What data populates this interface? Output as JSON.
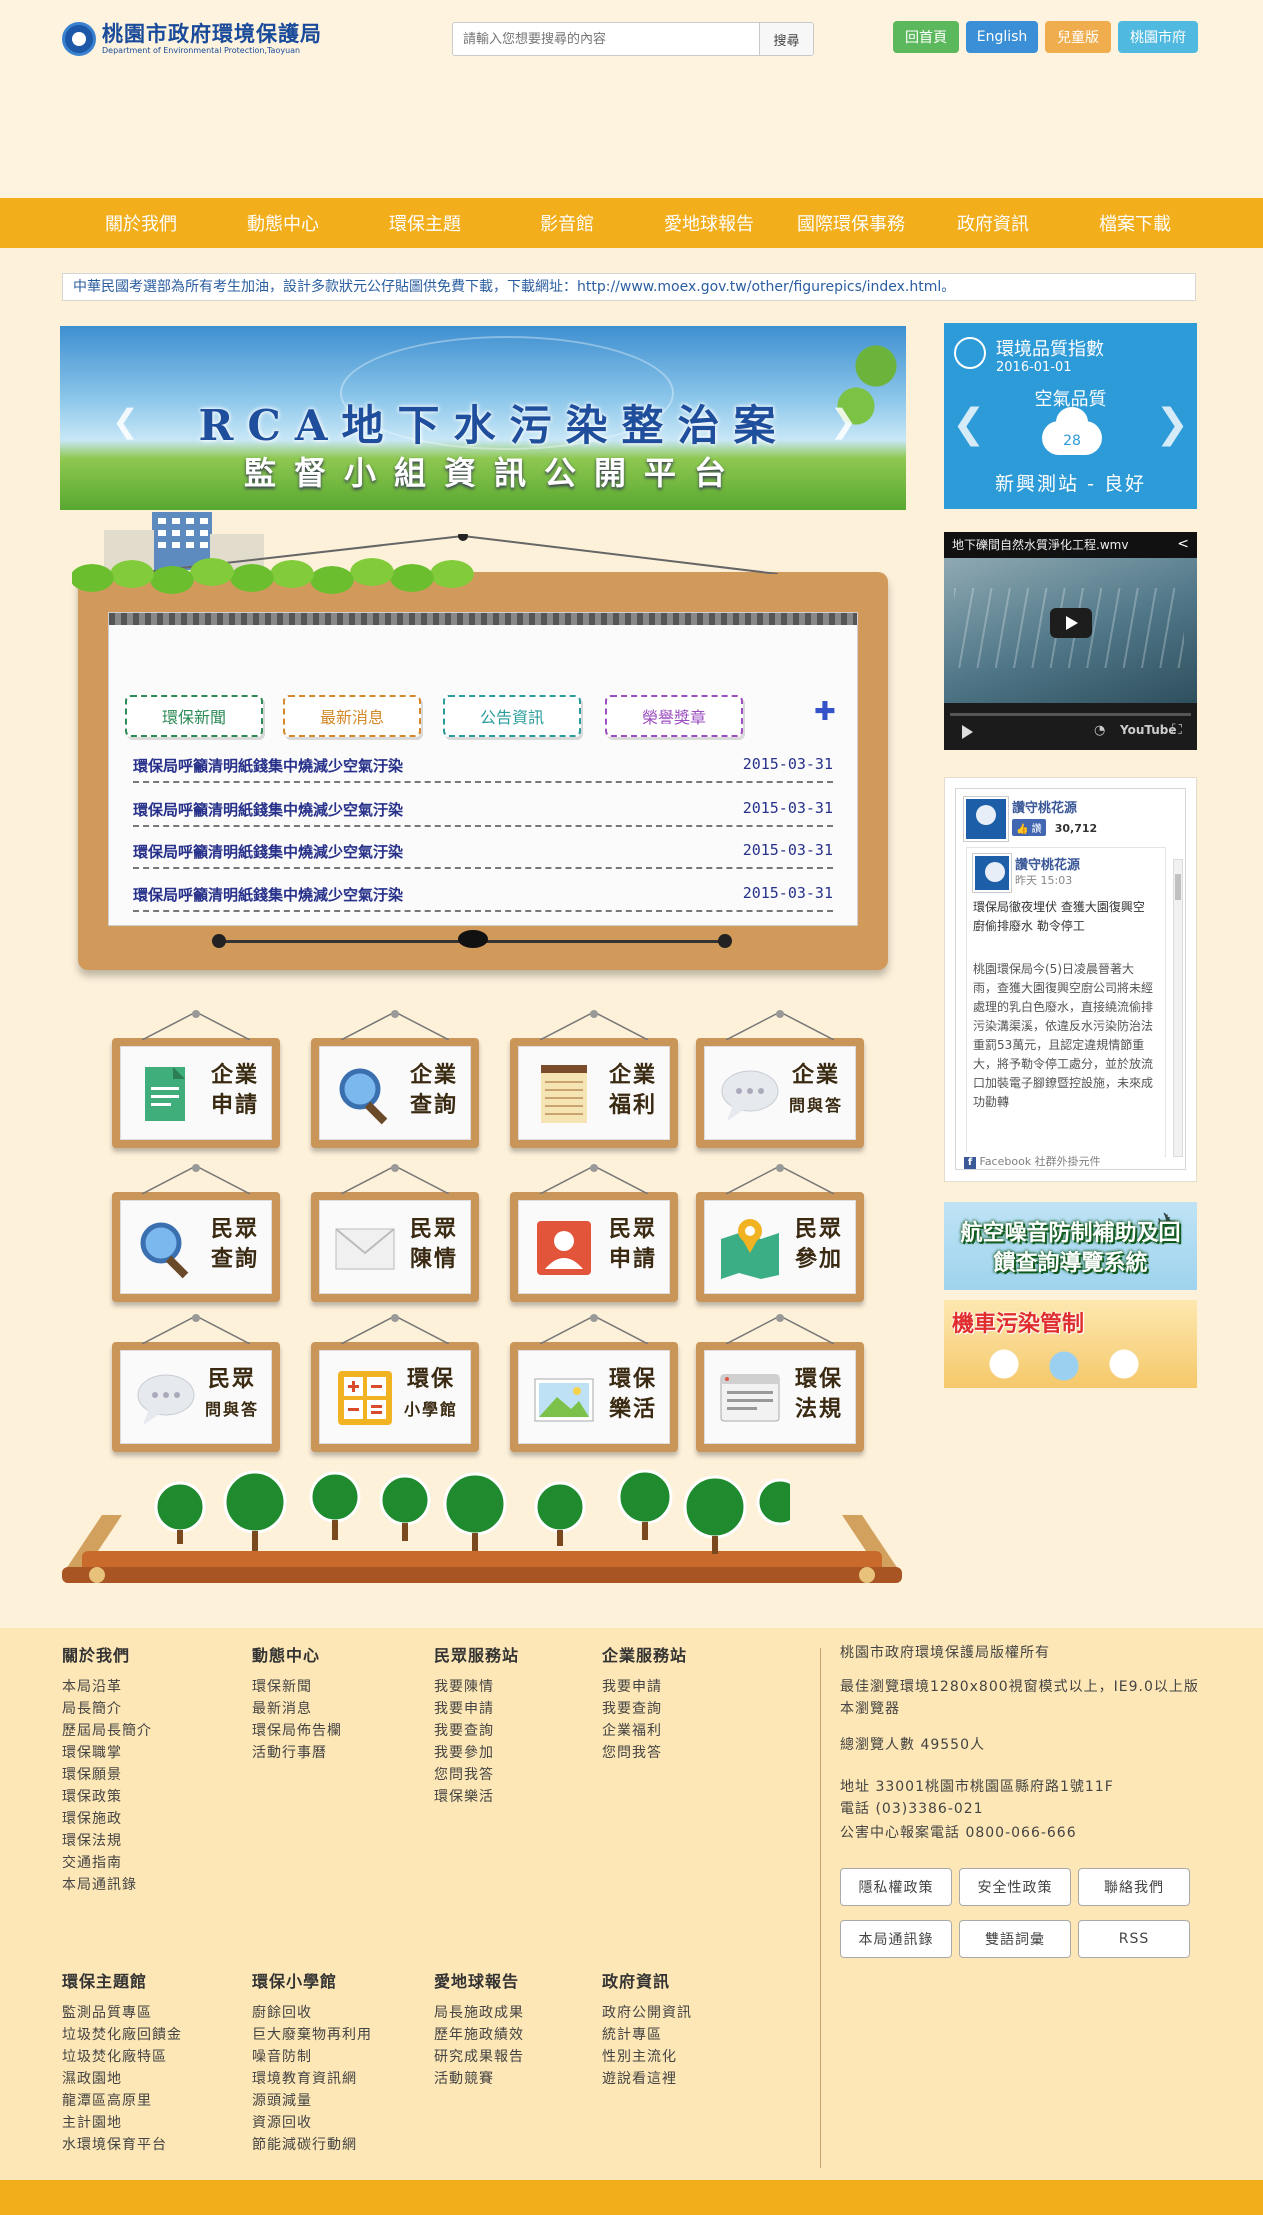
{
  "header": {
    "logo_title": "桃園市政府環境保護局",
    "logo_subtitle": "Department of Environmental Protection,Taoyuan",
    "search_placeholder": "請輸入您想要搜尋的內容",
    "search_button": "搜尋",
    "top_links": [
      {
        "label": "回首頁",
        "color": "#5cb85c"
      },
      {
        "label": "English",
        "color": "#3a8fd6"
      },
      {
        "label": "兒童版",
        "color": "#f0ad4e"
      },
      {
        "label": "桃園市府",
        "color": "#4fb9e0"
      }
    ]
  },
  "nav": [
    "關於我們",
    "動態中心",
    "環保主題",
    "影音館",
    "愛地球報告",
    "國際環保事務",
    "政府資訊",
    "檔案下載"
  ],
  "announcement": "中華民國考選部為所有考生加油，設計多款狀元公仔貼圖供免費下載，下載網址：http://www.moex.gov.tw/other/figurepics/index.html。",
  "banner": {
    "line1": "RCA地下水污染整治案",
    "line2": "監督小組資訊公開平台"
  },
  "aqi": {
    "title": "環境品質指數",
    "date": "2016-01-01",
    "subtitle": "空氣品質",
    "value": "28",
    "station": "新興測站 - 良好"
  },
  "video": {
    "title": "地下礫間自然水質淨化工程.wmv"
  },
  "facebook": {
    "page_name": "讚守桃花源",
    "like_label": "讚",
    "like_count": "30,712",
    "post_time": "昨天 15:03",
    "post_headline": "環保局徹夜埋伏 查獲大園復興空廚偷排廢水 勒令停工",
    "post_body": "桃園環保局今(5)日凌晨晉著大雨，查獲大園復興空廚公司將未經處理的乳白色廢水，直接繞流偷排污染溝渠溪，依違反水污染防治法重罰53萬元，且認定違規情節重大，將予勒令停工處分，並於放流口加裝電子腳鐐暨控設施，未來成功勸轉",
    "footer": "Facebook 社群外掛元件"
  },
  "ads": {
    "ad1": "航空噪音防制補助及回饋查詢導覽系統",
    "ad2": "機車污染管制"
  },
  "board": {
    "tabs": [
      {
        "label": "環保新聞",
        "color": "#2e8b57"
      },
      {
        "label": "最新消息",
        "color": "#d4892a"
      },
      {
        "label": "公告資訊",
        "color": "#2a9c9c"
      },
      {
        "label": "榮譽獎章",
        "color": "#9c4fc0"
      }
    ],
    "news": [
      {
        "title": "環保局呼籲清明紙錢集中燒減少空氣汙染",
        "date": "2015-03-31"
      },
      {
        "title": "環保局呼籲清明紙錢集中燒減少空氣汙染",
        "date": "2015-03-31"
      },
      {
        "title": "環保局呼籲清明紙錢集中燒減少空氣汙染",
        "date": "2015-03-31"
      },
      {
        "title": "環保局呼籲清明紙錢集中燒減少空氣汙染",
        "date": "2015-03-31"
      }
    ]
  },
  "tiles": [
    {
      "l1": "企業",
      "l2": "申請",
      "icon": "document-icon"
    },
    {
      "l1": "企業",
      "l2": "查詢",
      "icon": "magnifier-icon"
    },
    {
      "l1": "企業",
      "l2": "福利",
      "icon": "notepad-icon"
    },
    {
      "l1": "企業",
      "l2": "問與答",
      "icon": "chat-bubble-icon"
    },
    {
      "l1": "民眾",
      "l2": "查詢",
      "icon": "magnifier-icon"
    },
    {
      "l1": "民眾",
      "l2": "陳情",
      "icon": "envelope-icon"
    },
    {
      "l1": "民眾",
      "l2": "申請",
      "icon": "person-card-icon"
    },
    {
      "l1": "民眾",
      "l2": "參加",
      "icon": "map-pin-icon"
    },
    {
      "l1": "民眾",
      "l2": "問與答",
      "icon": "chat-bubble-icon"
    },
    {
      "l1": "環保",
      "l2": "小學館",
      "icon": "calculator-icon"
    },
    {
      "l1": "環保",
      "l2": "樂活",
      "icon": "picture-icon"
    },
    {
      "l1": "環保",
      "l2": "法規",
      "icon": "browser-window-icon"
    }
  ],
  "footer": {
    "columns_top": [
      {
        "title": "關於我們",
        "links": [
          "本局沿革",
          "局長簡介",
          "歷屆局長簡介",
          "環保職掌",
          "環保願景",
          "環保政策",
          "環保施政",
          "環保法規",
          "交通指南",
          "本局通訊錄"
        ]
      },
      {
        "title": "動態中心",
        "links": [
          "環保新聞",
          "最新消息",
          "環保局佈告欄",
          "活動行事曆"
        ]
      },
      {
        "title": "民眾服務站",
        "links": [
          "我要陳情",
          "我要申請",
          "我要查詢",
          "我要參加",
          "您問我答",
          "環保樂活"
        ]
      },
      {
        "title": "企業服務站",
        "links": [
          "我要申請",
          "我要查詢",
          "企業福利",
          "您問我答"
        ]
      }
    ],
    "columns_bottom": [
      {
        "title": "環保主題館",
        "links": [
          "監測品質專區",
          "垃圾焚化廠回饋金",
          "垃圾焚化廠特區",
          "濕政園地",
          "龍潭區高原里",
          "主計園地",
          "水環境保育平台"
        ]
      },
      {
        "title": "環保小學館",
        "links": [
          "廚餘回收",
          "巨大廢棄物再利用",
          "噪音防制",
          "環境教育資訊網",
          "源頭減量",
          "資源回收",
          "節能減碳行動網"
        ]
      },
      {
        "title": "愛地球報告",
        "links": [
          "局長施政成果",
          "歷年施政績效",
          "研究成果報告",
          "活動競賽"
        ]
      },
      {
        "title": "政府資訊",
        "links": [
          "政府公開資訊",
          "統計專區",
          "性別主流化",
          "遊說看這裡"
        ]
      }
    ],
    "copyright": "桃園市政府環境保護局版權所有",
    "browser_note": "最佳瀏覽環境1280x800視窗模式以上，IE9.0以上版本瀏覽器",
    "visitors": "總瀏覽人數 49550人",
    "address": "地址 33001桃園市桃園區縣府路1號11F",
    "phone": "電話 (03)3386-021",
    "hotline": "公害中心報案電話 0800-066-666",
    "buttons": [
      "隱私權政策",
      "安全性政策",
      "聯絡我們",
      "本局通訊錄",
      "雙語詞彙",
      "RSS"
    ]
  }
}
